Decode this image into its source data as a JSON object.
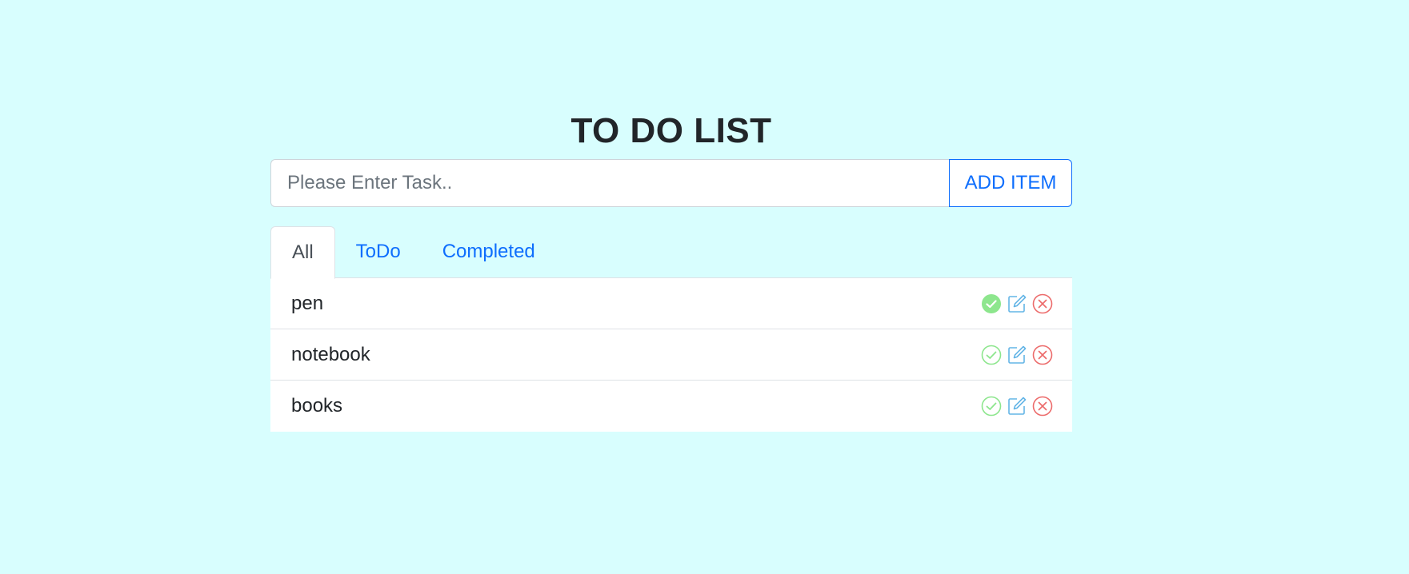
{
  "header": {
    "title": "TO DO LIST"
  },
  "form": {
    "placeholder": "Please Enter Task..",
    "value": "",
    "add_label": "ADD ITEM"
  },
  "tabs": [
    {
      "label": "All",
      "active": true
    },
    {
      "label": "ToDo",
      "active": false
    },
    {
      "label": "Completed",
      "active": false
    }
  ],
  "items": [
    {
      "label": "pen",
      "completed": true
    },
    {
      "label": "notebook",
      "completed": false
    },
    {
      "label": "books",
      "completed": false
    }
  ],
  "icons": {
    "complete": "check-circle-icon",
    "edit": "pencil-square-icon",
    "delete": "x-circle-icon"
  },
  "colors": {
    "background": "#d8fefe",
    "accent": "#0d6efd",
    "complete": "#8de68d",
    "edit": "#64b5e6",
    "delete": "#ec6b6b"
  }
}
